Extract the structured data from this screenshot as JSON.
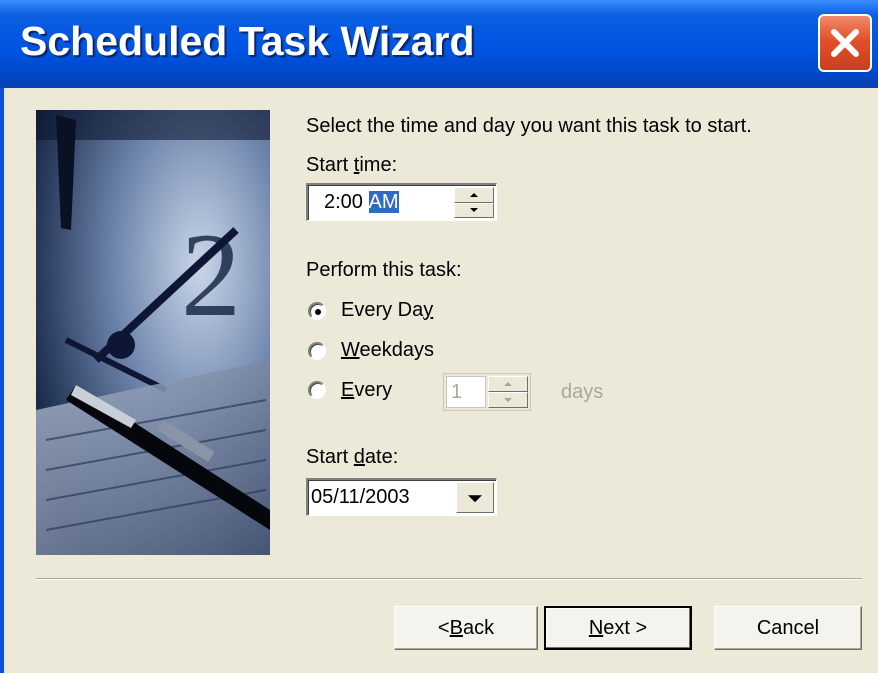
{
  "window": {
    "title": "Scheduled Task Wizard",
    "close_icon": "close-x-icon"
  },
  "prompt": "Select the time and day you want this task to start.",
  "start_time": {
    "label_pre": "Start ",
    "label_u": "t",
    "label_post": "ime:",
    "time": "2:00",
    "meridiem": "AM"
  },
  "perform": {
    "label": "Perform this task:",
    "options": [
      {
        "pre": "Every Da",
        "u": "y",
        "post": "",
        "selected": true
      },
      {
        "pre": "",
        "u": "W",
        "post": "eekdays",
        "selected": false
      },
      {
        "pre": "",
        "u": "E",
        "post": "very",
        "selected": false
      }
    ],
    "every_value": "1",
    "days_label": "days"
  },
  "start_date": {
    "label_pre": "Start ",
    "label_u": "d",
    "label_post": "ate:",
    "value": "05/11/2003"
  },
  "buttons": {
    "back": {
      "pre": "< ",
      "u": "B",
      "post": "ack"
    },
    "next": {
      "pre": "",
      "u": "N",
      "post": "ext >"
    },
    "cancel": "Cancel"
  },
  "colors": {
    "titlebar": "#0054E3",
    "close": "#E2502A",
    "dialog_bg": "#ECE9D8",
    "selection": "#316AC5"
  }
}
